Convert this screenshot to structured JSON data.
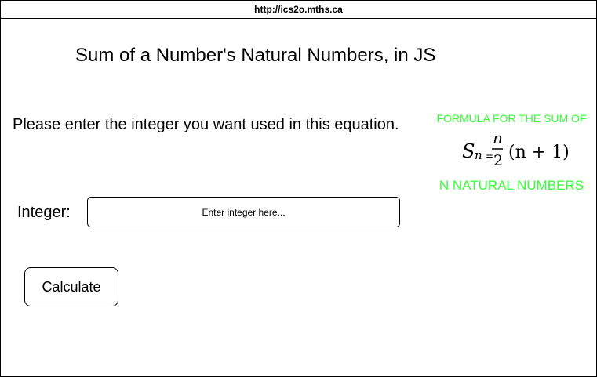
{
  "browser": {
    "url": "http://ics2o.mths.ca"
  },
  "page": {
    "title": "Sum of a Number's Natural Numbers, in JS",
    "prompt": "Please enter the integer you want used in this equation."
  },
  "formula_image": {
    "top_caption": "FORMULA FOR THE SUM OF",
    "bottom_caption": "N NATURAL NUMBERS",
    "symbol_S": "S",
    "symbol_n_sub": "n",
    "equals": "=",
    "numerator": "n",
    "denominator": "2",
    "rhs": "(n + 1)",
    "caption_color": "#33ff33"
  },
  "form": {
    "integer_label": "Integer:",
    "integer_placeholder": "Enter integer here...",
    "integer_value": "",
    "calculate_label": "Calculate"
  }
}
